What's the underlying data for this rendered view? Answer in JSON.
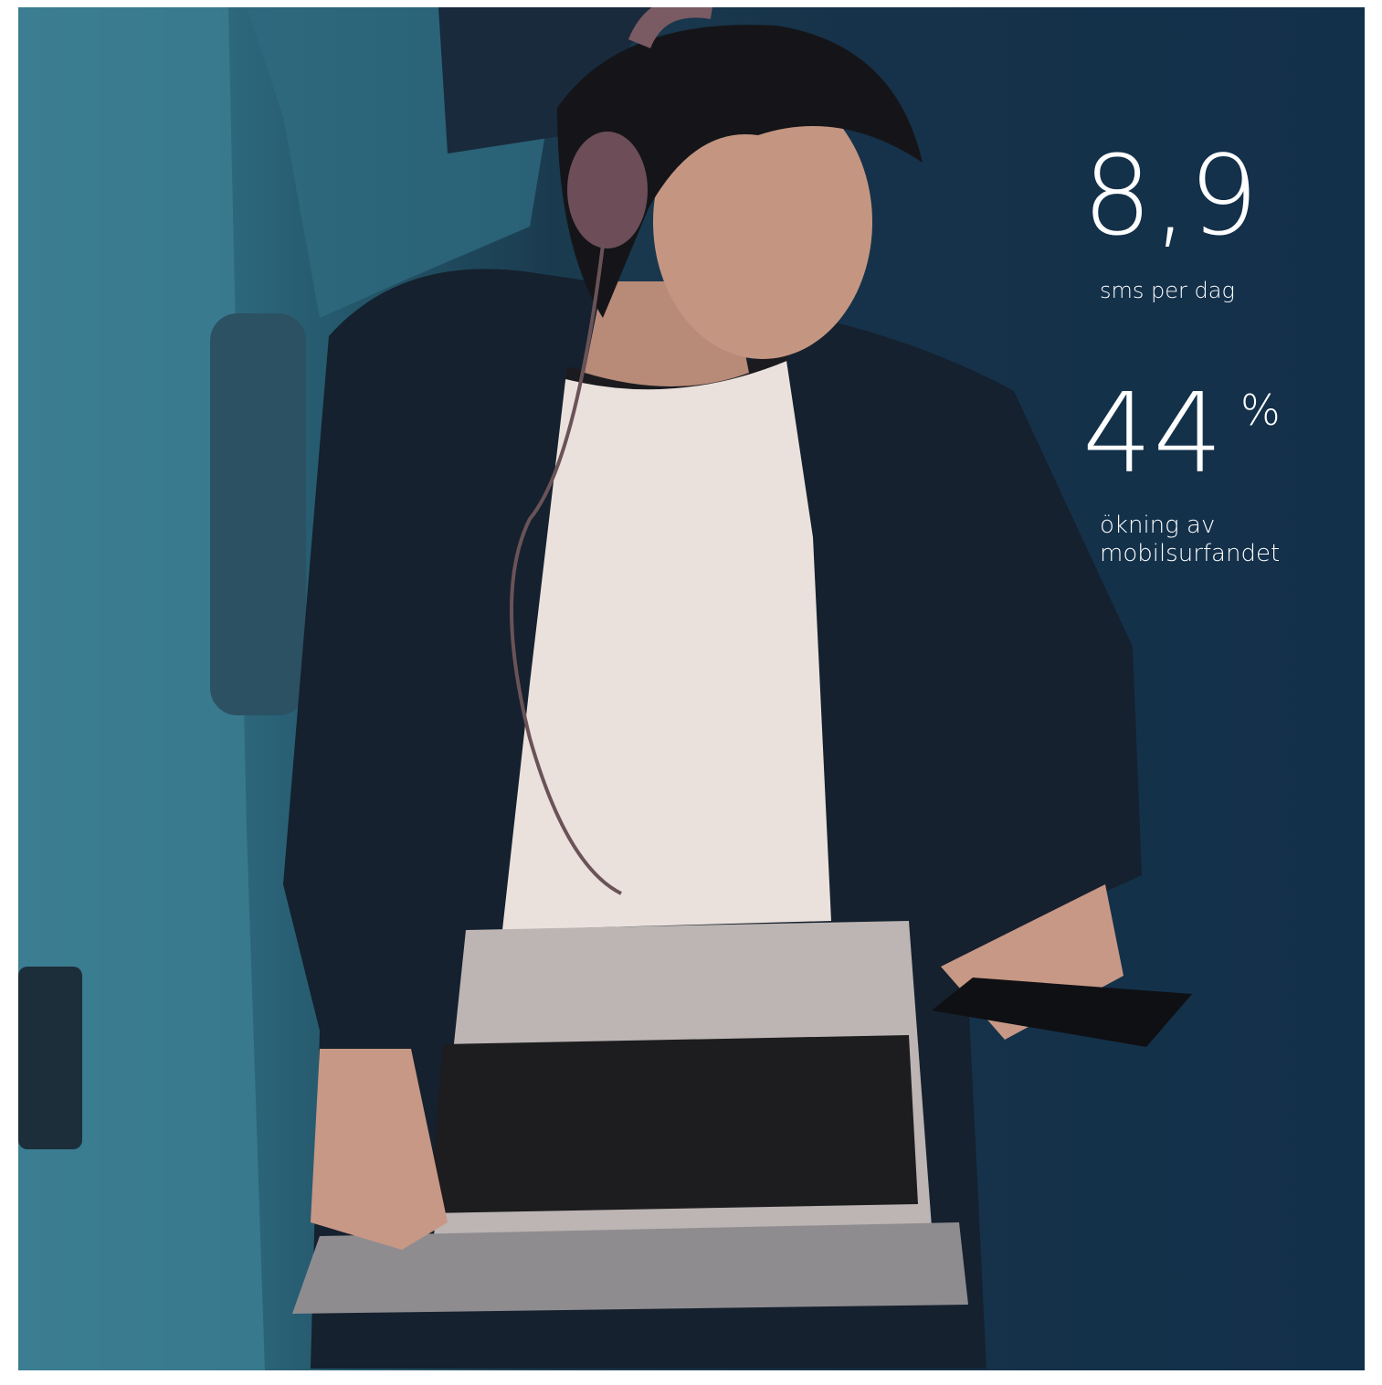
{
  "stats": {
    "sms_value": "8,9",
    "sms_label": "sms per dag",
    "growth_value": "44",
    "growth_unit": "%",
    "growth_label_line1": "ökning av",
    "growth_label_line2": "mobilsurfandet"
  },
  "colors": {
    "text": "#ffffff",
    "seat_teal": "#3f7f93",
    "background_dark": "#13304a"
  }
}
